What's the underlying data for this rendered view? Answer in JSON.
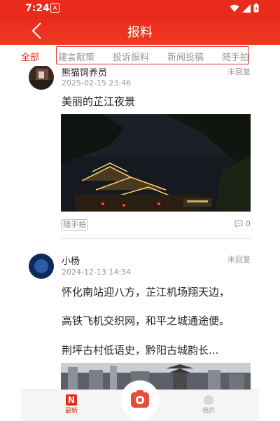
{
  "status_bar": {
    "time": "7:24",
    "notif_glyph": "A"
  },
  "header": {
    "title": "报料"
  },
  "tabs": [
    {
      "label": "全部",
      "active": true
    },
    {
      "label": "建言献策",
      "active": false
    },
    {
      "label": "投诉报料",
      "active": false
    },
    {
      "label": "新闻投稿",
      "active": false
    },
    {
      "label": "随手拍",
      "active": false
    }
  ],
  "posts": [
    {
      "username": "熊猫饲养员",
      "date": "2025-02-15 23:46",
      "status": "未回复",
      "text": "美丽的芷江夜景",
      "tag": "随手拍",
      "comment_count": "0"
    },
    {
      "username": "小杨",
      "date": "2024-12-13 14:34",
      "status": "未回复",
      "lines": [
        "怀化南站迎八方，芷江机场翔天边，",
        "高铁飞机交织网，和平之城通途便。",
        "荆坪古村低语史，黔阳古城韵长..."
      ]
    }
  ],
  "bottom_nav": {
    "latest": {
      "label": "最新",
      "icon_letter": "N"
    },
    "mine": {
      "label": "我的"
    }
  },
  "colors": {
    "brand_red": "#ea2a1b"
  }
}
